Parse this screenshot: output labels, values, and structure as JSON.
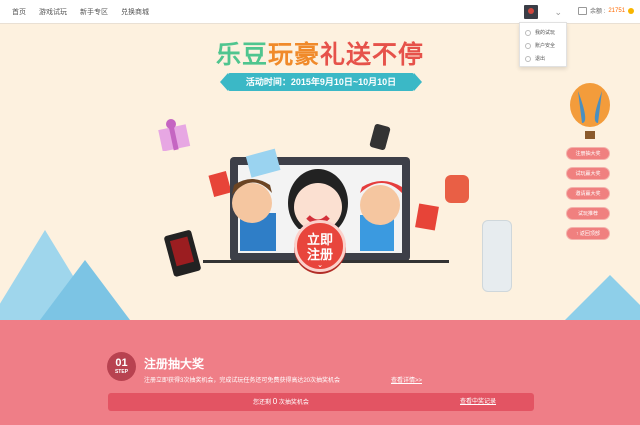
{
  "nav": {
    "items": [
      "首页",
      "游戏试玩",
      "新手专区",
      "兑换商城"
    ]
  },
  "wallet": {
    "label": "余额 :",
    "amount": "21751"
  },
  "user_menu": {
    "items": [
      "我的试玩",
      "账户安全",
      "退出"
    ]
  },
  "hero": {
    "title_parts": [
      "乐豆",
      "玩豪",
      "礼送不停"
    ],
    "date_text": "活动时间：2015年9月10日~10月10日",
    "cta_line1": "立即",
    "cta_line2": "注册"
  },
  "side_menu": {
    "items": [
      "注册抽大奖",
      "试玩赢大奖",
      "邀请赢大奖",
      "试玩推荐",
      "↑ 返回顶部"
    ]
  },
  "section": {
    "step_number": "01",
    "step_label": "STEP",
    "title": "注册抽大奖",
    "description": "注册立即获得3次抽奖机会，完成试玩任务还可免费获得高达20次抽奖机会",
    "details_link": "查看详情>>",
    "remaining_prefix": "您还剩",
    "remaining_count": "0",
    "remaining_suffix": "次抽奖机会",
    "records_link": "查看中奖记录"
  },
  "colors": {
    "accent": "#e8453c",
    "band": "#ef7e87",
    "teal": "#3bb8c6",
    "background": "#fdf1df"
  }
}
